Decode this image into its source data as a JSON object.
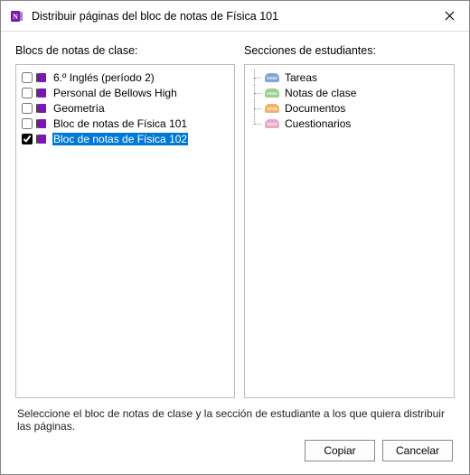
{
  "window": {
    "title": "Distribuir páginas del bloc de notas de Física 101"
  },
  "headings": {
    "notebooks": "Blocs de notas de clase:",
    "sections": "Secciones de estudiantes:"
  },
  "notebooks": [
    {
      "label": "6.º Inglés (período 2)",
      "checked": false,
      "selected": false,
      "color": "#7719aa"
    },
    {
      "label": "Personal de Bellows High",
      "checked": false,
      "selected": false,
      "color": "#7719aa"
    },
    {
      "label": "Geometría",
      "checked": false,
      "selected": false,
      "color": "#7719aa"
    },
    {
      "label": "Bloc de notas de Física 101",
      "checked": false,
      "selected": false,
      "color": "#7719aa"
    },
    {
      "label": "Bloc de notas de Física 102",
      "checked": true,
      "selected": true,
      "color": "#7719aa"
    }
  ],
  "sections": [
    {
      "label": "Tareas",
      "color": "#7ca7d8"
    },
    {
      "label": "Notas de clase",
      "color": "#9bcf8f"
    },
    {
      "label": "Documentos",
      "color": "#f2b263"
    },
    {
      "label": "Cuestionarios",
      "color": "#e8a8c8"
    }
  ],
  "instruction": "Seleccione el bloc de notas de clase y la sección de estudiante a los que quiera distribuir las páginas.",
  "buttons": {
    "copy": "Copiar",
    "cancel": "Cancelar"
  }
}
